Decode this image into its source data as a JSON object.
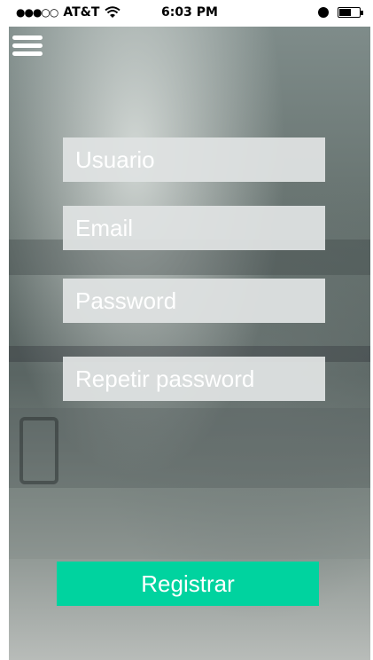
{
  "status_bar": {
    "signal": "●●●○○",
    "carrier": "AT&T",
    "time": "6:03 PM"
  },
  "icons": {
    "menu": "hamburger-menu-icon",
    "wifi": "wifi-icon",
    "alarm": "alarm-icon",
    "battery": "battery-icon"
  },
  "form": {
    "usuario_placeholder": "Usuario",
    "email_placeholder": "Email",
    "password_placeholder": "Password",
    "repeat_password_placeholder": "Repetir password",
    "submit_label": "Registrar"
  },
  "colors": {
    "accent": "#00d39f",
    "field_bg": "#dee1e2"
  }
}
